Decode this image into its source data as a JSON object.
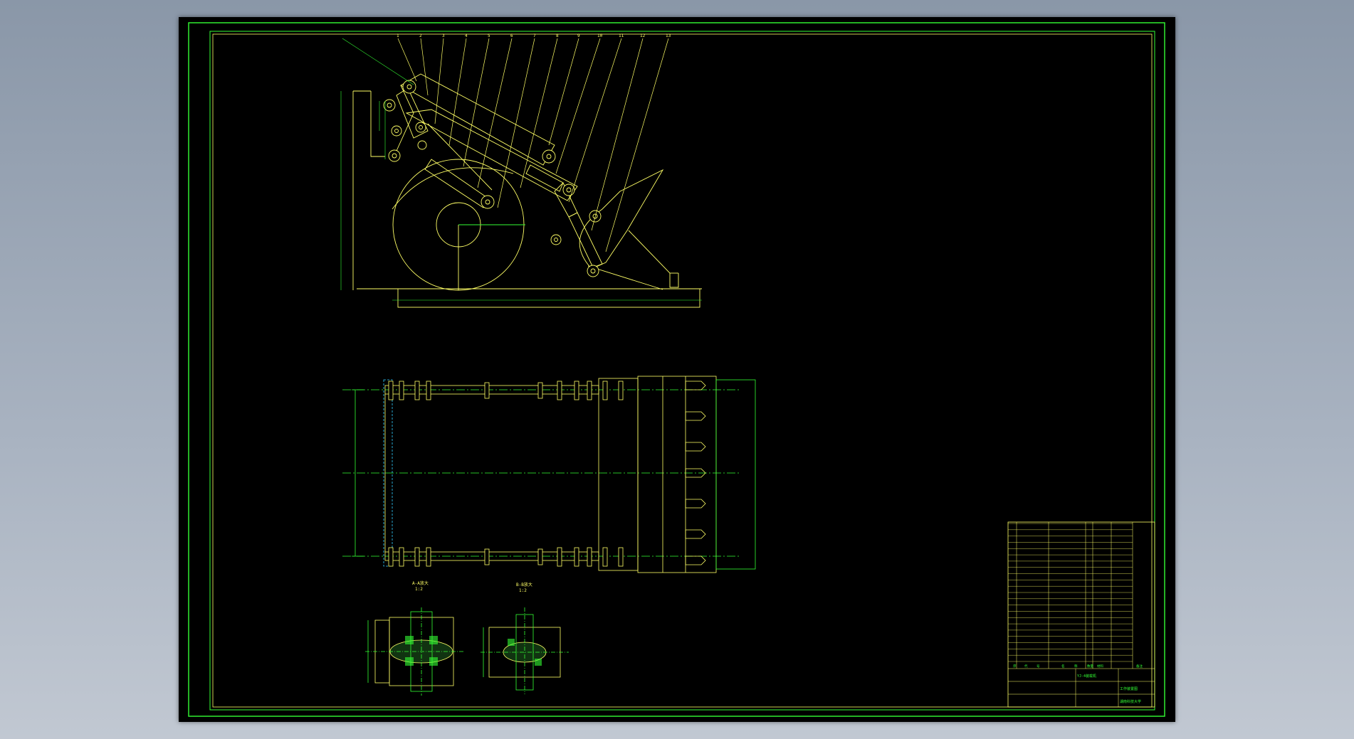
{
  "drawing": {
    "background_color": "#000000",
    "frame_color": "#33ff33",
    "geometry_color": "#ffff66",
    "centerline_color": "#33ff33",
    "hidden_color": "#33ccff"
  },
  "side_view": {
    "balloon_numbers": [
      "1",
      "2",
      "3",
      "4",
      "5",
      "6",
      "7",
      "8",
      "9",
      "10",
      "11",
      "12",
      "13"
    ]
  },
  "section_views": {
    "left_label": "A-A放大",
    "left_scale": "1:2",
    "right_label": "B-B放大",
    "right_scale": "1:2"
  },
  "title_block": {
    "parts_rows": 22,
    "header_labels": [
      "序",
      "代",
      "号",
      "名",
      "称",
      "数量",
      "材料",
      "备注"
    ],
    "drawing_title": "YJ-4装载机",
    "assembly_title": "工作装置图",
    "school": "湖南科技大学"
  }
}
